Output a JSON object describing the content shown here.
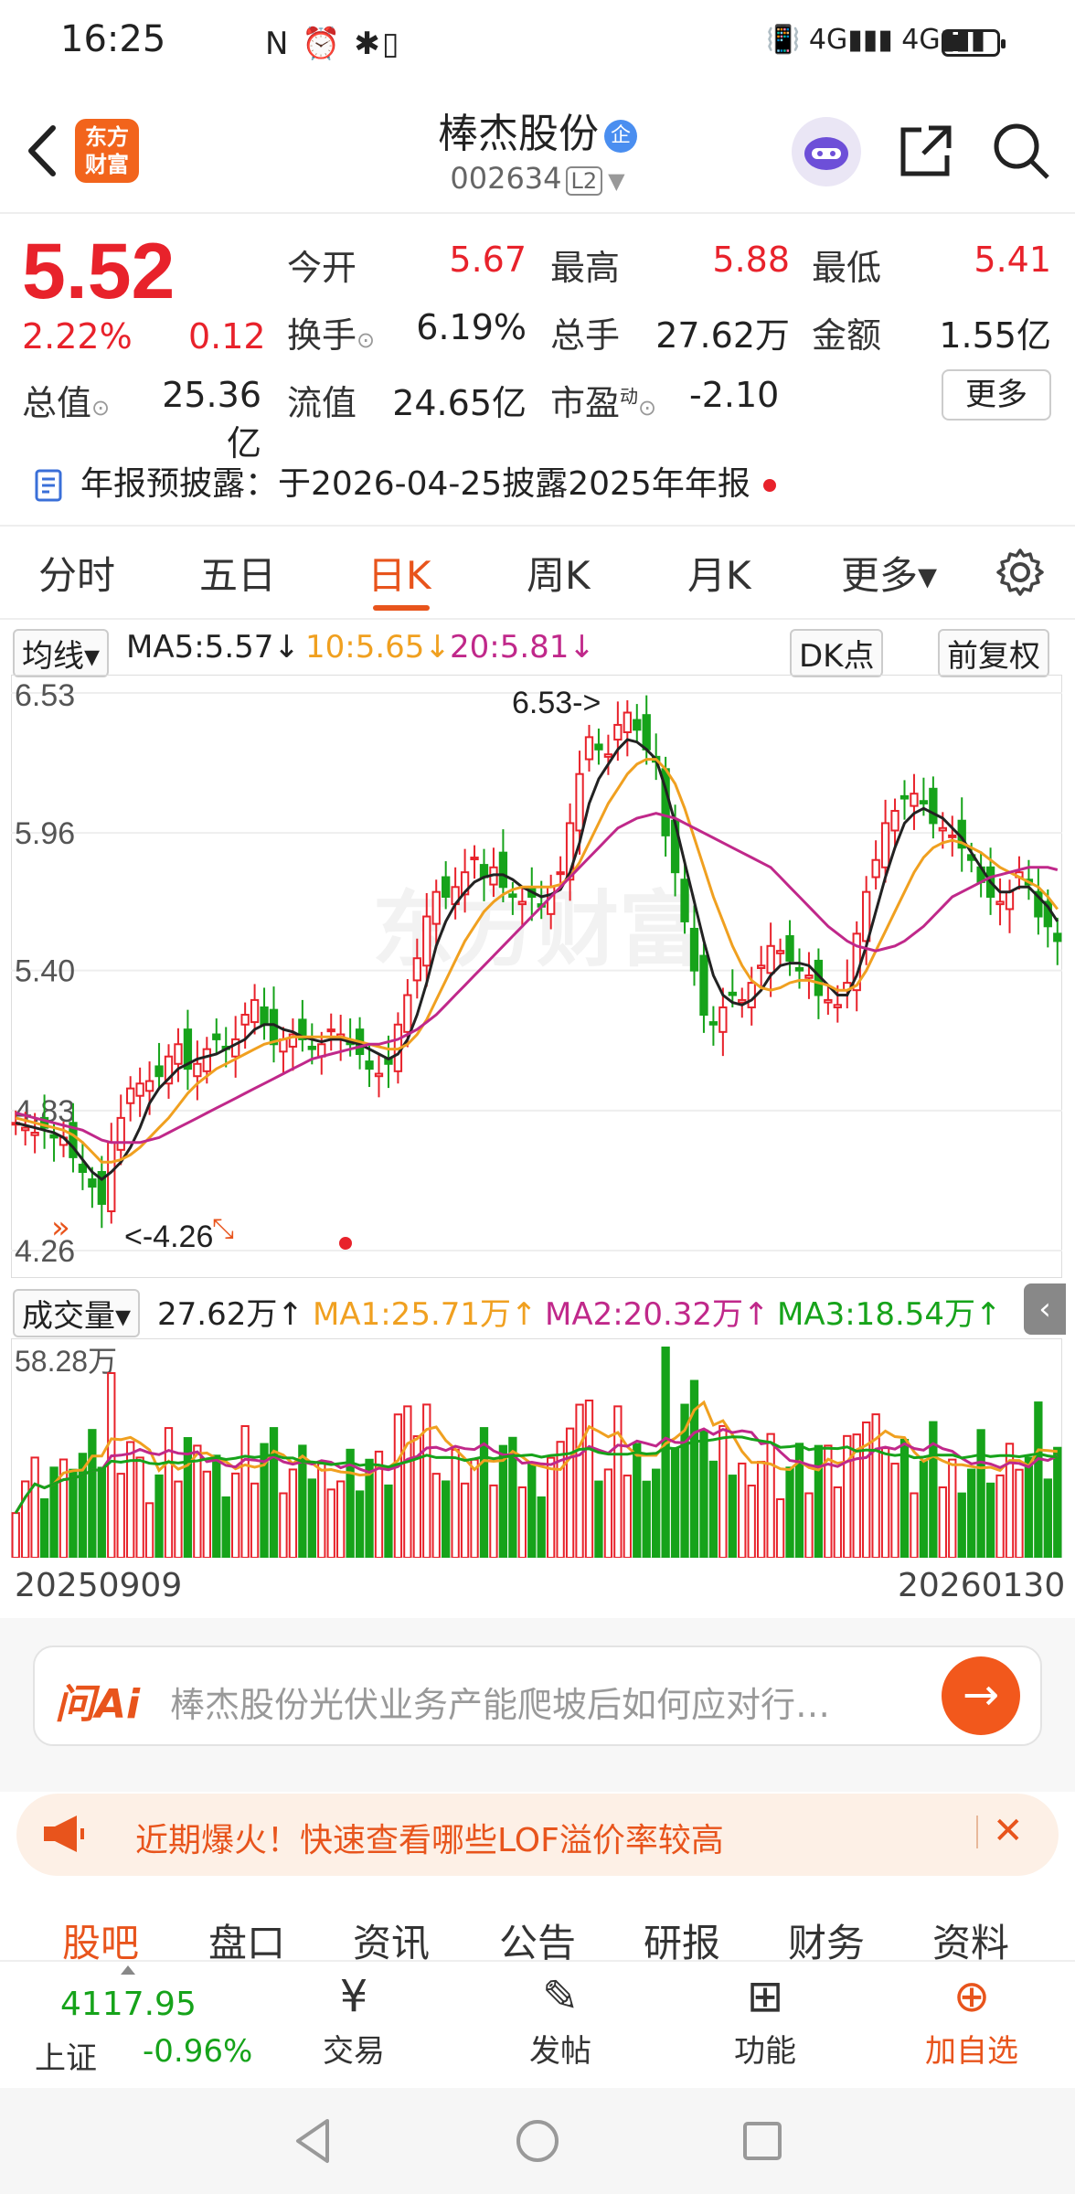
{
  "status_bar": {
    "time": "16:25",
    "icons_left": "N ⏰ ✱▯",
    "network": "📳 4G▮▮▮ 4G▮▮▮"
  },
  "header": {
    "back_icon": "chevron-left-icon",
    "logo_text_1": "东方",
    "logo_text_2": "财富",
    "stock_name": "棒杰股份",
    "badge": "企",
    "stock_code": "002634",
    "level": "L2",
    "share_icon": "share-icon",
    "search_icon": "search-icon"
  },
  "quote": {
    "price": "5.52",
    "change_pct": "2.22%",
    "change_amt": "0.12",
    "open_label": "今开",
    "open": "5.67",
    "high_label": "最高",
    "high": "5.88",
    "low_label": "最低",
    "low": "5.41",
    "turnover_label": "换手",
    "turnover": "6.19%",
    "volume_label": "总手",
    "volume": "27.62万",
    "amount_label": "金额",
    "amount": "1.55亿",
    "mktcap_label": "总值",
    "mktcap": "25.36亿",
    "float_label": "流值",
    "float_cap": "24.65亿",
    "pe_label": "市盈",
    "pe_sup": "动",
    "pe": "-2.10",
    "more_label": "更多"
  },
  "notice": {
    "text": "年报预披露：于2026-04-25披露2025年年报"
  },
  "tabs": [
    {
      "label": "分时"
    },
    {
      "label": "五日"
    },
    {
      "label": "日K"
    },
    {
      "label": "周K"
    },
    {
      "label": "月K"
    },
    {
      "label": "更多▾"
    }
  ],
  "ma_bar": {
    "selector": "均线▾",
    "ma5": "MA5:5.57↓",
    "ma10": "10:5.65↓",
    "ma20": "20:5.81↓",
    "dk": "DK点",
    "adjust": "前复权",
    "colors": {
      "ma5": "#222222",
      "ma10": "#f0a020",
      "ma20": "#c0288a",
      "up": "#e8222b",
      "down": "#16a31a"
    }
  },
  "chart_data": {
    "type": "candlestick",
    "y_ticks": [
      "6.53",
      "5.96",
      "5.40",
      "4.83",
      "4.26"
    ],
    "ylim": [
      4.26,
      6.53
    ],
    "max_marker": "6.53->",
    "min_marker": "<-4.26",
    "watermark": "东方财富",
    "x_start": "20250909",
    "x_end": "20260130",
    "closes": [
      4.78,
      4.76,
      4.74,
      4.76,
      4.72,
      4.72,
      4.64,
      4.58,
      4.52,
      4.45,
      4.7,
      4.8,
      4.92,
      4.94,
      4.95,
      4.97,
      5.05,
      5.1,
      5.0,
      5.02,
      5.08,
      5.12,
      5.08,
      5.12,
      5.22,
      5.28,
      5.18,
      5.1,
      5.12,
      5.14,
      5.12,
      5.08,
      5.1,
      5.16,
      5.14,
      5.1,
      5.06,
      5.0,
      4.98,
      5.02,
      5.18,
      5.3,
      5.45,
      5.62,
      5.72,
      5.7,
      5.74,
      5.8,
      5.86,
      5.78,
      5.82,
      5.74,
      5.7,
      5.68,
      5.7,
      5.66,
      5.74,
      5.8,
      6.0,
      6.2,
      6.35,
      6.3,
      6.28,
      6.4,
      6.45,
      6.38,
      6.3,
      6.25,
      5.95,
      5.8,
      5.6,
      5.4,
      5.22,
      5.18,
      5.25,
      5.3,
      5.28,
      5.35,
      5.42,
      5.5,
      5.48,
      5.44,
      5.4,
      5.38,
      5.3,
      5.28,
      5.26,
      5.35,
      5.55,
      5.72,
      5.85,
      6.0,
      6.05,
      6.1,
      6.12,
      6.08,
      6.0,
      5.98,
      5.95,
      5.9,
      5.85,
      5.76,
      5.7,
      5.68,
      5.72,
      5.8,
      5.75,
      5.62,
      5.58,
      5.52
    ],
    "ma5": [
      4.78,
      4.77,
      4.76,
      4.75,
      4.74,
      4.72,
      4.68,
      4.63,
      4.58,
      4.55,
      4.58,
      4.62,
      4.68,
      4.76,
      4.86,
      4.92,
      4.96,
      5.0,
      5.02,
      5.04,
      5.05,
      5.06,
      5.08,
      5.1,
      5.12,
      5.16,
      5.18,
      5.18,
      5.16,
      5.15,
      5.13,
      5.12,
      5.11,
      5.12,
      5.12,
      5.11,
      5.1,
      5.08,
      5.06,
      5.04,
      5.06,
      5.12,
      5.22,
      5.35,
      5.5,
      5.6,
      5.67,
      5.72,
      5.76,
      5.78,
      5.79,
      5.79,
      5.77,
      5.74,
      5.72,
      5.7,
      5.71,
      5.73,
      5.8,
      5.92,
      6.08,
      6.18,
      6.24,
      6.3,
      6.34,
      6.33,
      6.3,
      6.26,
      6.14,
      6.0,
      5.84,
      5.68,
      5.52,
      5.38,
      5.3,
      5.27,
      5.26,
      5.28,
      5.32,
      5.38,
      5.42,
      5.43,
      5.43,
      5.42,
      5.38,
      5.34,
      5.3,
      5.3,
      5.38,
      5.5,
      5.64,
      5.78,
      5.9,
      6.0,
      6.04,
      6.06,
      6.04,
      6.02,
      5.98,
      5.94,
      5.88,
      5.82,
      5.76,
      5.72,
      5.72,
      5.74,
      5.74,
      5.7,
      5.66,
      5.6
    ],
    "ma10": [
      4.8,
      4.79,
      4.78,
      4.77,
      4.76,
      4.75,
      4.73,
      4.7,
      4.66,
      4.62,
      4.62,
      4.63,
      4.65,
      4.68,
      4.72,
      4.76,
      4.8,
      4.85,
      4.9,
      4.94,
      4.97,
      5.0,
      5.02,
      5.04,
      5.06,
      5.08,
      5.1,
      5.11,
      5.12,
      5.13,
      5.13,
      5.13,
      5.13,
      5.13,
      5.13,
      5.12,
      5.11,
      5.1,
      5.09,
      5.08,
      5.08,
      5.1,
      5.14,
      5.2,
      5.28,
      5.36,
      5.44,
      5.52,
      5.58,
      5.64,
      5.68,
      5.71,
      5.73,
      5.74,
      5.74,
      5.74,
      5.74,
      5.75,
      5.78,
      5.84,
      5.92,
      6.0,
      6.08,
      6.14,
      6.2,
      6.24,
      6.26,
      6.26,
      6.22,
      6.16,
      6.06,
      5.94,
      5.82,
      5.7,
      5.6,
      5.5,
      5.42,
      5.36,
      5.33,
      5.32,
      5.33,
      5.35,
      5.36,
      5.36,
      5.35,
      5.34,
      5.32,
      5.32,
      5.34,
      5.4,
      5.48,
      5.56,
      5.64,
      5.72,
      5.8,
      5.86,
      5.9,
      5.92,
      5.93,
      5.92,
      5.9,
      5.88,
      5.85,
      5.82,
      5.8,
      5.78,
      5.76,
      5.74,
      5.7,
      5.65
    ],
    "ma20": [
      4.82,
      4.81,
      4.8,
      4.79,
      4.78,
      4.77,
      4.76,
      4.75,
      4.73,
      4.71,
      4.7,
      4.7,
      4.7,
      4.7,
      4.71,
      4.72,
      4.74,
      4.76,
      4.78,
      4.8,
      4.82,
      4.84,
      4.86,
      4.88,
      4.9,
      4.92,
      4.94,
      4.96,
      4.98,
      5.0,
      5.02,
      5.04,
      5.05,
      5.06,
      5.07,
      5.08,
      5.09,
      5.1,
      5.1,
      5.11,
      5.12,
      5.14,
      5.16,
      5.19,
      5.22,
      5.26,
      5.3,
      5.34,
      5.38,
      5.42,
      5.46,
      5.5,
      5.54,
      5.58,
      5.62,
      5.66,
      5.7,
      5.74,
      5.78,
      5.82,
      5.86,
      5.9,
      5.94,
      5.98,
      6.0,
      6.02,
      6.03,
      6.04,
      6.03,
      6.02,
      6.0,
      5.98,
      5.96,
      5.94,
      5.92,
      5.9,
      5.88,
      5.86,
      5.84,
      5.82,
      5.78,
      5.74,
      5.7,
      5.66,
      5.62,
      5.58,
      5.55,
      5.52,
      5.5,
      5.49,
      5.48,
      5.49,
      5.5,
      5.52,
      5.55,
      5.58,
      5.62,
      5.66,
      5.7,
      5.72,
      5.74,
      5.76,
      5.78,
      5.79,
      5.8,
      5.81,
      5.82,
      5.82,
      5.82,
      5.81
    ]
  },
  "volume_bar": {
    "selector": "成交量▾",
    "current": "27.62万↑",
    "ma1": "MA1:25.71万↑",
    "ma2": "MA2:20.32万↑",
    "ma3": "MA3:18.54万↑",
    "max_label": "58.28万"
  },
  "ai_search": {
    "logo": "问Ai",
    "placeholder": "棒杰股份光伏业务产能爬坡后如何应对行…"
  },
  "promo": {
    "text": "近期爆火！快速查看哪些LOF溢价率较高"
  },
  "sub_tabs": [
    {
      "label": "股吧"
    },
    {
      "label": "盘口"
    },
    {
      "label": "资讯"
    },
    {
      "label": "公告"
    },
    {
      "label": "研报"
    },
    {
      "label": "财务"
    },
    {
      "label": "资料"
    }
  ],
  "bottom_bar": {
    "index_value": "4117.95",
    "index_name": "上证",
    "index_change": "-0.96%",
    "trade": "交易",
    "post": "发帖",
    "functions": "功能",
    "add_watch": "加自选"
  }
}
